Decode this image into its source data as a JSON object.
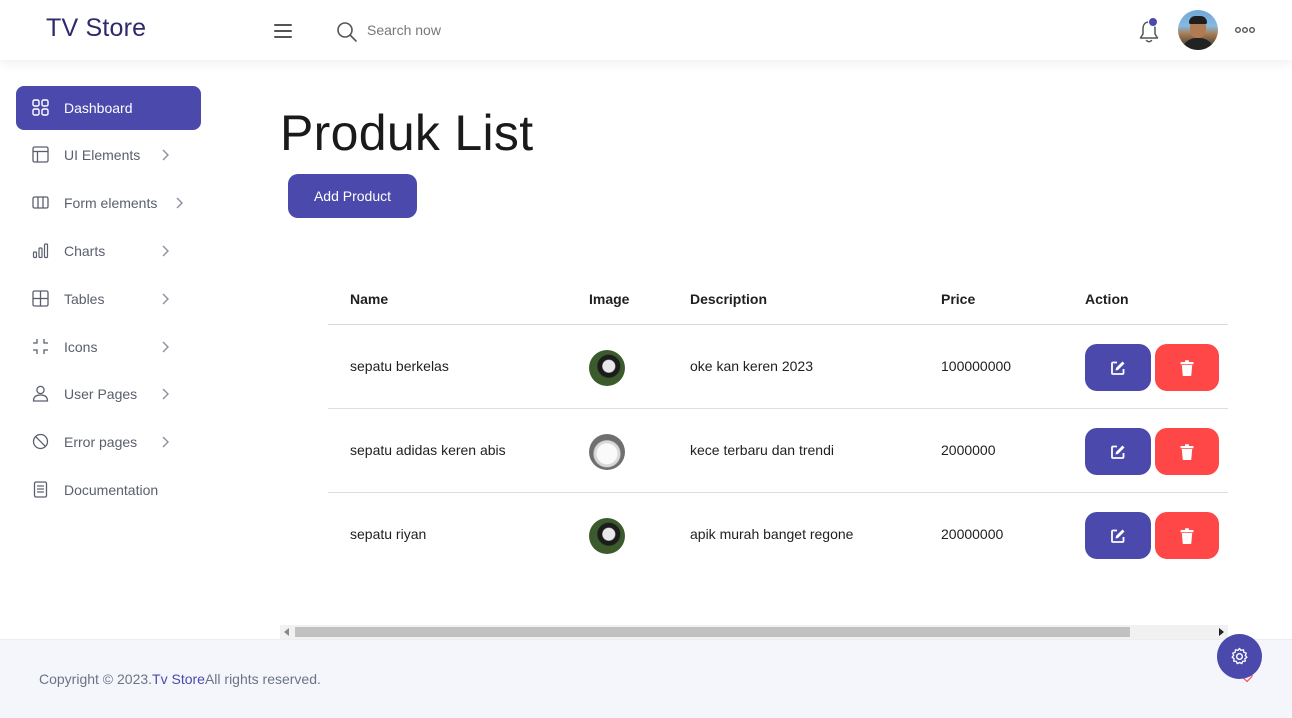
{
  "header": {
    "brand": "TV Store",
    "search_placeholder": "Search now"
  },
  "sidebar": {
    "items": [
      {
        "label": "Dashboard",
        "icon": "grid-icon"
      },
      {
        "label": "UI Elements",
        "icon": "layout-icon"
      },
      {
        "label": "Form elements",
        "icon": "columns-icon"
      },
      {
        "label": "Charts",
        "icon": "bar-chart-icon"
      },
      {
        "label": "Tables",
        "icon": "table-icon"
      },
      {
        "label": "Icons",
        "icon": "expand-icon"
      },
      {
        "label": "User Pages",
        "icon": "user-icon"
      },
      {
        "label": "Error pages",
        "icon": "ban-icon"
      },
      {
        "label": "Documentation",
        "icon": "document-icon"
      }
    ]
  },
  "main": {
    "title": "Produk List",
    "add_button": "Add Product",
    "table": {
      "headers": [
        "Name",
        "Image",
        "Description",
        "Price",
        "Action"
      ],
      "rows": [
        {
          "name": "sepatu berkelas",
          "image": "dark-shoe",
          "description": "oke kan keren 2023",
          "price": "100000000"
        },
        {
          "name": "sepatu adidas keren abis",
          "image": "white-shoe",
          "description": "kece terbaru dan trendi",
          "price": "2000000"
        },
        {
          "name": "sepatu riyan",
          "image": "dark-shoe",
          "description": "apik murah banget regone",
          "price": "20000000"
        }
      ]
    }
  },
  "footer": {
    "copyright_prefix": "Copyright © 2023.",
    "brand_link": "Tv Store",
    "copyright_suffix": "All rights reserved."
  },
  "colors": {
    "accent": "#4b49ac",
    "danger": "#ff4747",
    "footer_bg": "#f4f6fc"
  }
}
